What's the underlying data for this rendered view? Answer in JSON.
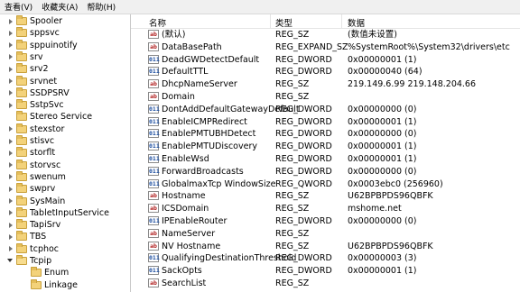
{
  "menubar": {
    "items": [
      "查看(V)",
      "收藏夹(A)",
      "帮助(H)"
    ]
  },
  "tree": [
    {
      "label": "Spooler",
      "level": 0,
      "expander": "closed"
    },
    {
      "label": "sppsvc",
      "level": 0,
      "expander": "closed"
    },
    {
      "label": "sppuinotify",
      "level": 0,
      "expander": "closed"
    },
    {
      "label": "srv",
      "level": 0,
      "expander": "closed"
    },
    {
      "label": "srv2",
      "level": 0,
      "expander": "closed"
    },
    {
      "label": "srvnet",
      "level": 0,
      "expander": "closed"
    },
    {
      "label": "SSDPSRV",
      "level": 0,
      "expander": "closed"
    },
    {
      "label": "SstpSvc",
      "level": 0,
      "expander": "closed"
    },
    {
      "label": "Stereo Service",
      "level": 0,
      "expander": "none"
    },
    {
      "label": "stexstor",
      "level": 0,
      "expander": "closed"
    },
    {
      "label": "stisvc",
      "level": 0,
      "expander": "closed"
    },
    {
      "label": "storflt",
      "level": 0,
      "expander": "closed"
    },
    {
      "label": "storvsc",
      "level": 0,
      "expander": "closed"
    },
    {
      "label": "swenum",
      "level": 0,
      "expander": "closed"
    },
    {
      "label": "swprv",
      "level": 0,
      "expander": "closed"
    },
    {
      "label": "SysMain",
      "level": 0,
      "expander": "closed"
    },
    {
      "label": "TabletInputService",
      "level": 0,
      "expander": "closed"
    },
    {
      "label": "TapiSrv",
      "level": 0,
      "expander": "closed"
    },
    {
      "label": "TBS",
      "level": 0,
      "expander": "closed"
    },
    {
      "label": "tcphoc",
      "level": 0,
      "expander": "closed"
    },
    {
      "label": "Tcpip",
      "level": 0,
      "expander": "open"
    },
    {
      "label": "Enum",
      "level": 1,
      "expander": "none"
    },
    {
      "label": "Linkage",
      "level": 1,
      "expander": "none"
    }
  ],
  "columns": {
    "name": "名称",
    "type": "类型",
    "data": "数据"
  },
  "values": [
    {
      "icon": "ab",
      "name": "(默认)",
      "type": "REG_SZ",
      "data": "(数值未设置)"
    },
    {
      "icon": "ab",
      "name": "DataBasePath",
      "type": "REG_EXPAND_SZ",
      "data": "%SystemRoot%\\System32\\drivers\\etc"
    },
    {
      "icon": "dw",
      "name": "DeadGWDetectDefault",
      "type": "REG_DWORD",
      "data": "0x00000001 (1)"
    },
    {
      "icon": "dw",
      "name": "DefaultTTL",
      "type": "REG_DWORD",
      "data": "0x00000040 (64)"
    },
    {
      "icon": "ab",
      "name": "DhcpNameServer",
      "type": "REG_SZ",
      "data": "219.149.6.99 219.148.204.66"
    },
    {
      "icon": "ab",
      "name": "Domain",
      "type": "REG_SZ",
      "data": ""
    },
    {
      "icon": "dw",
      "name": "DontAddDefaultGatewayDefault",
      "type": "REG_DWORD",
      "data": "0x00000000 (0)"
    },
    {
      "icon": "dw",
      "name": "EnableICMPRedirect",
      "type": "REG_DWORD",
      "data": "0x00000001 (1)"
    },
    {
      "icon": "dw",
      "name": "EnablePMTUBHDetect",
      "type": "REG_DWORD",
      "data": "0x00000000 (0)"
    },
    {
      "icon": "dw",
      "name": "EnablePMTUDiscovery",
      "type": "REG_DWORD",
      "data": "0x00000001 (1)"
    },
    {
      "icon": "dw",
      "name": "EnableWsd",
      "type": "REG_DWORD",
      "data": "0x00000001 (1)"
    },
    {
      "icon": "dw",
      "name": "ForwardBroadcasts",
      "type": "REG_DWORD",
      "data": "0x00000000 (0)"
    },
    {
      "icon": "dw",
      "name": "GlobalmaxTcp WindowSize",
      "type": "REG_QWORD",
      "data": "0x0003ebc0 (256960)"
    },
    {
      "icon": "ab",
      "name": "Hostname",
      "type": "REG_SZ",
      "data": "U62BPBPDS96QBFK"
    },
    {
      "icon": "ab",
      "name": "ICSDomain",
      "type": "REG_SZ",
      "data": "mshome.net"
    },
    {
      "icon": "dw",
      "name": "IPEnableRouter",
      "type": "REG_DWORD",
      "data": "0x00000000 (0)"
    },
    {
      "icon": "ab",
      "name": "NameServer",
      "type": "REG_SZ",
      "data": ""
    },
    {
      "icon": "ab",
      "name": "NV Hostname",
      "type": "REG_SZ",
      "data": "U62BPBPDS96QBFK"
    },
    {
      "icon": "dw",
      "name": "QualifyingDestinationThreshold",
      "type": "REG_DWORD",
      "data": "0x00000003 (3)"
    },
    {
      "icon": "dw",
      "name": "SackOpts",
      "type": "REG_DWORD",
      "data": "0x00000001 (1)"
    },
    {
      "icon": "ab",
      "name": "SearchList",
      "type": "REG_SZ",
      "data": ""
    }
  ]
}
